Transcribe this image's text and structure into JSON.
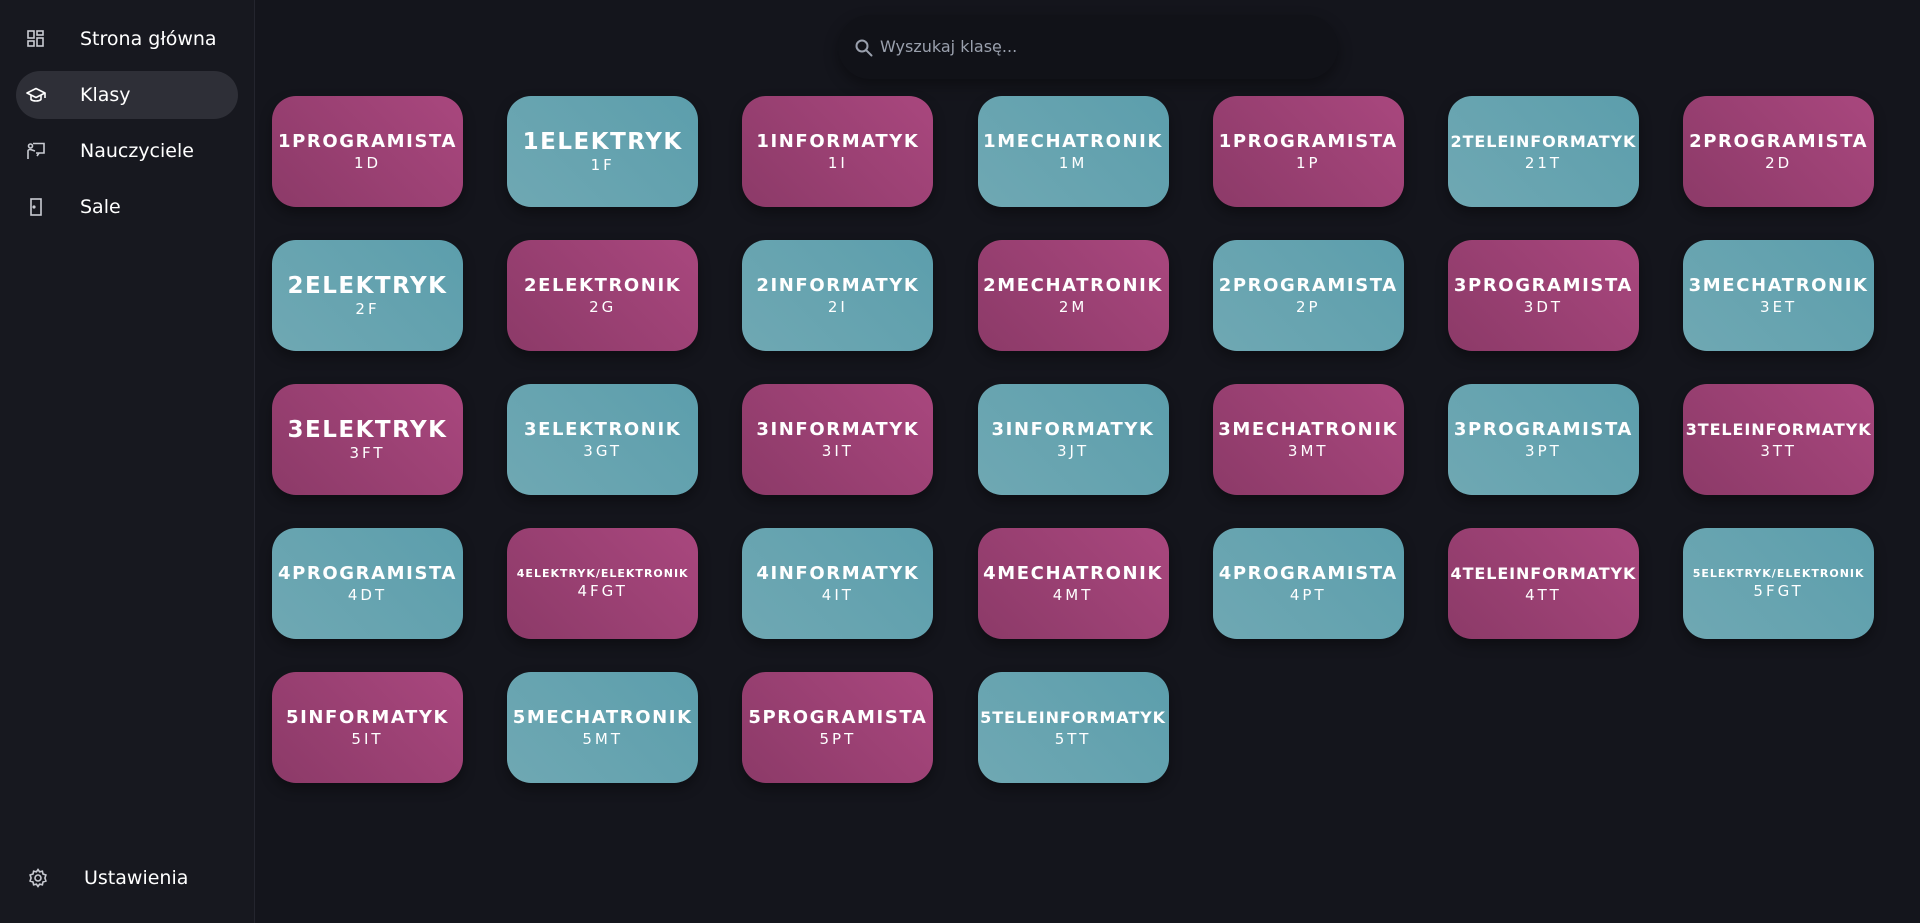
{
  "sidebar": {
    "items": [
      {
        "label": "Strona główna",
        "icon": "dashboard-icon"
      },
      {
        "label": "Klasy",
        "icon": "graduation-cap-icon",
        "active": true
      },
      {
        "label": "Nauczyciele",
        "icon": "teacher-icon"
      },
      {
        "label": "Sale",
        "icon": "door-icon"
      }
    ],
    "settings": {
      "label": "Ustawienia",
      "icon": "gear-icon"
    }
  },
  "search": {
    "placeholder": "Wyszukaj klasę..."
  },
  "colors": {
    "pink": "#9c4174",
    "teal": "#65a3b0",
    "background": "#14151c",
    "sidebar": "#17181f"
  },
  "classes": [
    {
      "name": "1PROGRAMISTA",
      "code": "1D",
      "color": "pink"
    },
    {
      "name": "1ELEKTRYK",
      "code": "1F",
      "color": "teal"
    },
    {
      "name": "1INFORMATYK",
      "code": "1I",
      "color": "pink"
    },
    {
      "name": "1MECHATRONIK",
      "code": "1M",
      "color": "teal"
    },
    {
      "name": "1PROGRAMISTA",
      "code": "1P",
      "color": "pink"
    },
    {
      "name": "2TELEINFORMATYK",
      "code": "21T",
      "color": "teal"
    },
    {
      "name": "2PROGRAMISTA",
      "code": "2D",
      "color": "pink"
    },
    {
      "name": "2ELEKTRYK",
      "code": "2F",
      "color": "teal"
    },
    {
      "name": "2ELEKTRONIK",
      "code": "2G",
      "color": "pink"
    },
    {
      "name": "2INFORMATYK",
      "code": "2I",
      "color": "teal"
    },
    {
      "name": "2MECHATRONIK",
      "code": "2M",
      "color": "pink"
    },
    {
      "name": "2PROGRAMISTA",
      "code": "2P",
      "color": "teal"
    },
    {
      "name": "3PROGRAMISTA",
      "code": "3DT",
      "color": "pink"
    },
    {
      "name": "3MECHATRONIK",
      "code": "3ET",
      "color": "teal"
    },
    {
      "name": "3ELEKTRYK",
      "code": "3FT",
      "color": "pink"
    },
    {
      "name": "3ELEKTRONIK",
      "code": "3GT",
      "color": "teal"
    },
    {
      "name": "3INFORMATYK",
      "code": "3IT",
      "color": "pink"
    },
    {
      "name": "3INFORMATYK",
      "code": "3JT",
      "color": "teal"
    },
    {
      "name": "3MECHATRONIK",
      "code": "3MT",
      "color": "pink"
    },
    {
      "name": "3PROGRAMISTA",
      "code": "3PT",
      "color": "teal"
    },
    {
      "name": "3TELEINFORMATYK",
      "code": "3TT",
      "color": "pink"
    },
    {
      "name": "4PROGRAMISTA",
      "code": "4DT",
      "color": "teal"
    },
    {
      "name": "4ELEKTRYK/ELEKTRONIK",
      "code": "4FGT",
      "color": "pink"
    },
    {
      "name": "4INFORMATYK",
      "code": "4IT",
      "color": "teal"
    },
    {
      "name": "4MECHATRONIK",
      "code": "4MT",
      "color": "pink"
    },
    {
      "name": "4PROGRAMISTA",
      "code": "4PT",
      "color": "teal"
    },
    {
      "name": "4TELEINFORMATYK",
      "code": "4TT",
      "color": "pink"
    },
    {
      "name": "5ELEKTRYK/ELEKTRONIK",
      "code": "5FGT",
      "color": "teal"
    },
    {
      "name": "5INFORMATYK",
      "code": "5IT",
      "color": "pink"
    },
    {
      "name": "5MECHATRONIK",
      "code": "5MT",
      "color": "teal"
    },
    {
      "name": "5PROGRAMISTA",
      "code": "5PT",
      "color": "pink"
    },
    {
      "name": "5TELEINFORMATYK",
      "code": "5TT",
      "color": "teal"
    }
  ]
}
